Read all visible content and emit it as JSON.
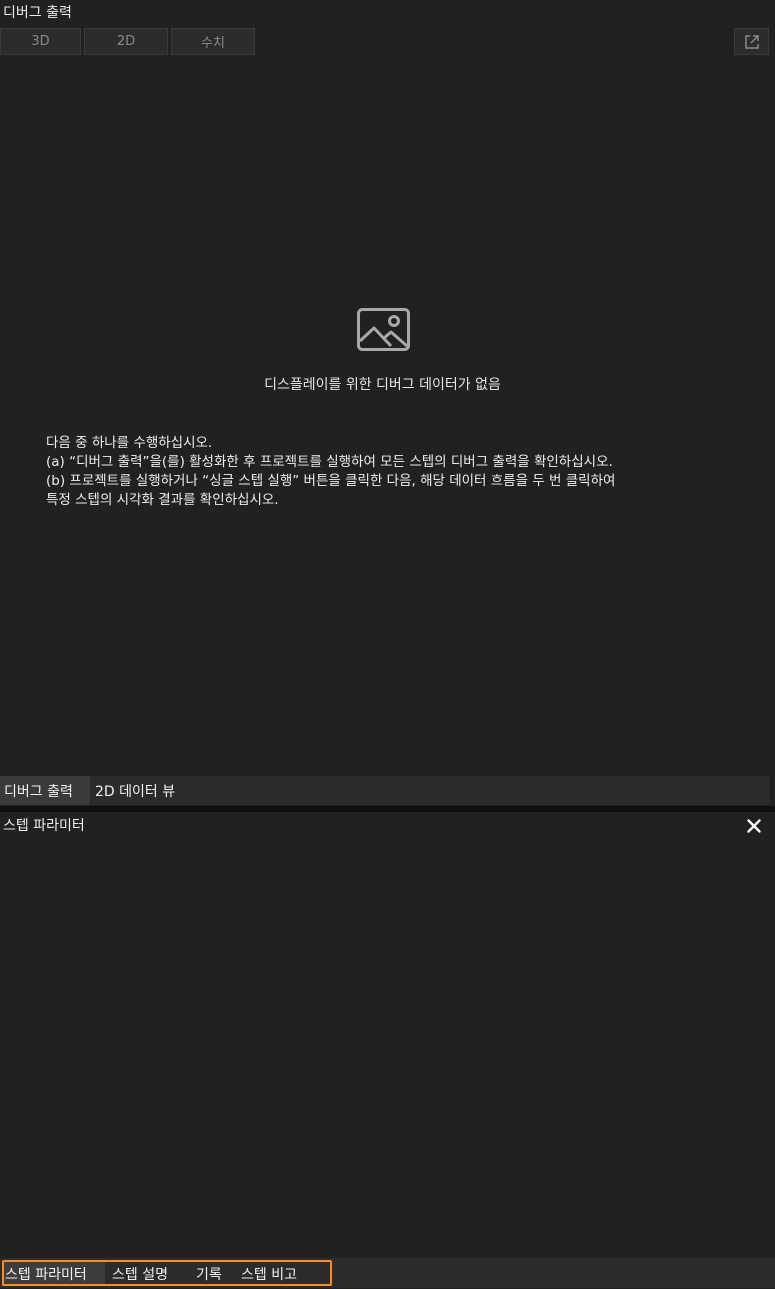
{
  "debug_panel": {
    "title": "디버그 출력",
    "view_tabs": [
      "3D",
      "2D",
      "수치"
    ],
    "popout_icon": "external-link-icon",
    "empty_icon": "image-placeholder-icon",
    "empty_message": "디스플레이를 위한 디버그 데이터가 없음",
    "help_lines": [
      "다음 중 하나를 수행하십시오.",
      "(a) “디버그 출력”을(를) 활성화한 후 프로젝트를 실행하여 모든 스텝의 디버그 출력을 확인하십시오.",
      "(b) 프로젝트를 실행하거나 “싱글 스텝 실행” 버튼을 클릭한 다음, 해당 데이터 흐름을 두 번 클릭하여",
      "특정 스텝의 시각화 결과를 확인하십시오."
    ],
    "bottom_tabs": [
      "디버그 출력",
      "2D 데이터 뷰"
    ]
  },
  "param_panel": {
    "title": "스텝 파라미터",
    "close_icon": "close-icon",
    "bottom_tabs": [
      "스텝 파라미터",
      "스텝 설명",
      "기록",
      "스텝 비고"
    ]
  },
  "colors": {
    "background": "#202020",
    "highlight": "#ff8a1f"
  }
}
